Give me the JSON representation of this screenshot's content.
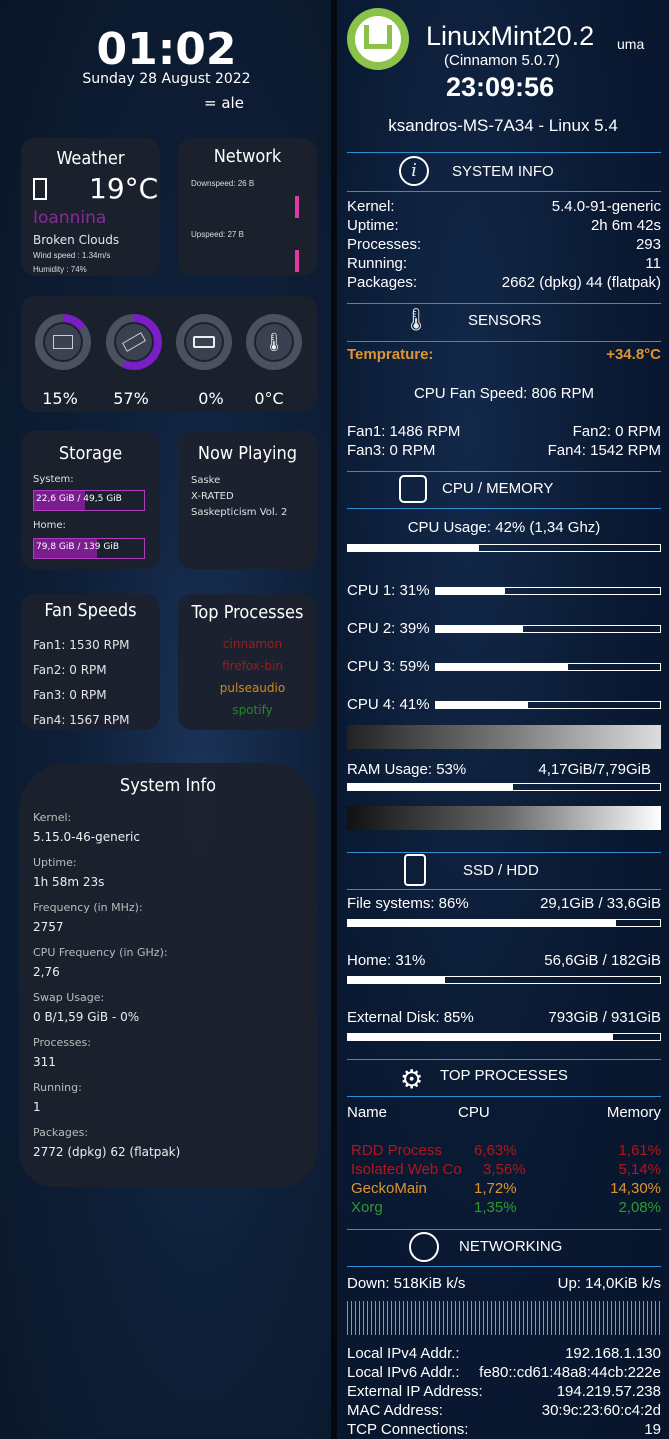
{
  "clock": {
    "time": "01:02",
    "date": "Sunday 28 August 2022",
    "user": "= ale"
  },
  "weather": {
    "title": "Weather",
    "icon": "",
    "temp": "19°C",
    "city": "Ioannina",
    "desc": "Broken Clouds",
    "wind": "Wind speed : 1.34m/s",
    "humidity": "Humidity : 74%"
  },
  "network": {
    "title": "Network",
    "down": "Downspeed: 26 B",
    "up": "Upspeed: 27 B"
  },
  "gauges": [
    {
      "icon": "cpu-icon",
      "value": "15%",
      "level": 0.15
    },
    {
      "icon": "memory-icon",
      "value": "57%",
      "level": 0.57
    },
    {
      "icon": "battery-icon",
      "value": "0%",
      "level": 0
    },
    {
      "icon": "thermometer-icon",
      "value": "0°C",
      "level": 0
    }
  ],
  "storage": {
    "title": "Storage",
    "system_label": "System:",
    "system_value": "22,6 GiB / 49,5 GiB",
    "system_level": 0.46,
    "home_label": "Home:",
    "home_value": "79,8 GiB / 139 GiB",
    "home_level": 0.57
  },
  "now_playing": {
    "title": "Now Playing",
    "artist": "Saske",
    "track": "X-RATED",
    "album": "Saskepticism Vol. 2"
  },
  "fan_speeds": {
    "title": "Fan Speeds",
    "fans": [
      "Fan1: 1530 RPM",
      "Fan2: 0 RPM",
      "Fan3: 0 RPM",
      "Fan4: 1567 RPM"
    ]
  },
  "top_processes_card": {
    "title": "Top Processes",
    "items": [
      {
        "name": "cinnamon",
        "color": "#a11a1a"
      },
      {
        "name": "firefox-bin",
        "color": "#a11a1a"
      },
      {
        "name": "pulseaudio",
        "color": "#d08a1a"
      },
      {
        "name": "spotify",
        "color": "#1f8a1f"
      }
    ]
  },
  "system_info_card": {
    "title": "System Info",
    "rows": [
      {
        "label": "Kernel:",
        "value": "5.15.0-46-generic"
      },
      {
        "label": "Uptime:",
        "value": "1h 58m 23s"
      },
      {
        "label": "Frequency (in MHz):",
        "value": "2757"
      },
      {
        "label": "CPU Frequency (in GHz):",
        "value": "2,76"
      },
      {
        "label": "Swap Usage:",
        "value": "0 B/1,59 GiB - 0%"
      },
      {
        "label": "Processes:",
        "value": "311"
      },
      {
        "label": "Running:",
        "value": "1"
      },
      {
        "label": "Packages:",
        "value": "2772 (dpkg) 62 (flatpak)"
      }
    ]
  },
  "right": {
    "distro": "LinuxMint20.2",
    "distro_sub": "uma",
    "de": "(Cinnamon 5.0.7)",
    "time": "23:09:56",
    "host": "ksandros-MS-7A34 - Linux 5.4",
    "sysinfo_title": "SYSTEM INFO",
    "sysinfo": [
      {
        "label": "Kernel:",
        "value": "5.4.0-91-generic"
      },
      {
        "label": "Uptime:",
        "value": "2h 6m 42s"
      },
      {
        "label": "Processes:",
        "value": "293"
      },
      {
        "label": "Running:",
        "value": "11"
      },
      {
        "label": "Packages:",
        "value": "2662 (dpkg) 44 (flatpak)"
      }
    ],
    "sensors_title": "SENSORS",
    "temp_label": "Temprature:",
    "temp_value": "+34.8°C",
    "temp_color": "#e0942e",
    "cpu_fan": "CPU Fan Speed: 806 RPM",
    "fan1": "Fan1: 1486 RPM",
    "fan2": "Fan2: 0 RPM",
    "fan3": "Fan3: 0 RPM",
    "fan4": "Fan4: 1542 RPM",
    "cpumem_title": "CPU / MEMORY",
    "cpu_usage": "CPU Usage: 42% (1,34 Ghz)",
    "cpu_usage_level": 0.42,
    "cores": [
      {
        "label": "CPU 1: 31%",
        "level": 0.31
      },
      {
        "label": "CPU 2: 39%",
        "level": 0.39
      },
      {
        "label": "CPU 3: 59%",
        "level": 0.59
      },
      {
        "label": "CPU 4: 41%",
        "level": 0.41
      }
    ],
    "ram_label": "RAM Usage: 53%",
    "ram_value": "4,17GiB/7,79GiB",
    "ram_level": 0.53,
    "disk_title": "SSD / HDD",
    "disks": [
      {
        "label": "File systems: 86%",
        "value": "29,1GiB / 33,6GiB",
        "level": 0.86
      },
      {
        "label": "Home: 31%",
        "value": "56,6GiB / 182GiB",
        "level": 0.31
      },
      {
        "label": "External Disk: 85%",
        "value": "793GiB / 931GiB",
        "level": 0.85
      }
    ],
    "top_title": "TOP PROCESSES",
    "top_head": {
      "name": "Name",
      "cpu": "CPU",
      "mem": "Memory"
    },
    "top_rows": [
      {
        "name": "RDD Process",
        "cpu": "6,63%",
        "mem": "1,61%",
        "color": "#b3161a"
      },
      {
        "name": "Isolated Web Co",
        "cpu": "3,56%",
        "mem": "5,14%",
        "color": "#b3161a"
      },
      {
        "name": "GeckoMain",
        "cpu": "1,72%",
        "mem": "14,30%",
        "color": "#e0942e"
      },
      {
        "name": "Xorg",
        "cpu": "1,35%",
        "mem": "2,08%",
        "color": "#2e9a2e"
      }
    ],
    "net_title": "NETWORKING",
    "down": "Down: 518KiB k/s",
    "up": "Up: 14,0KiB k/s",
    "net_rows": [
      {
        "label": "Local IPv4 Addr.:",
        "value": "192.168.1.130"
      },
      {
        "label": "Local IPv6 Addr.:",
        "value": "fe80::cd61:48a8:44cb:222e"
      },
      {
        "label": "External IP Address:",
        "value": "194.219.57.238"
      },
      {
        "label": "MAC Address:",
        "value": "30:9c:23:60:c4:2d"
      },
      {
        "label": "TCP Connections:",
        "value": "19"
      }
    ]
  }
}
